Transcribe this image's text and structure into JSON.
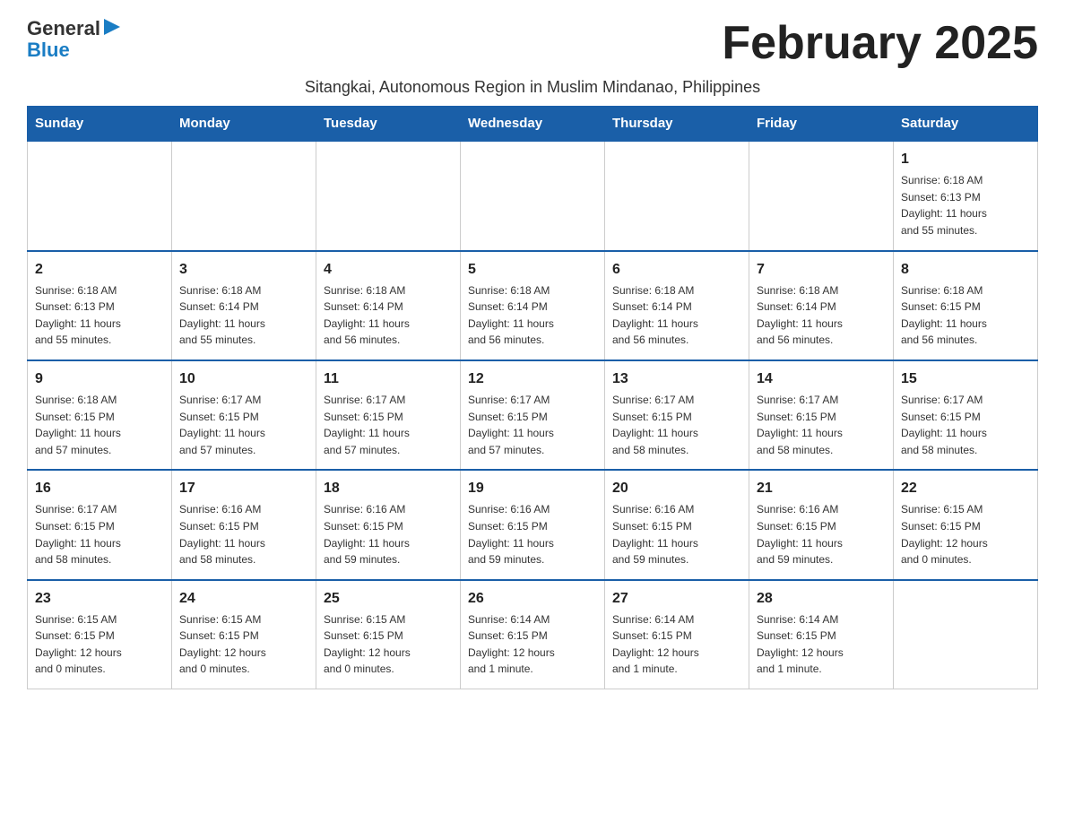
{
  "logo": {
    "general": "General",
    "blue": "Blue",
    "arrow": "▶"
  },
  "header": {
    "month_title": "February 2025",
    "subtitle": "Sitangkai, Autonomous Region in Muslim Mindanao, Philippines"
  },
  "days_of_week": [
    "Sunday",
    "Monday",
    "Tuesday",
    "Wednesday",
    "Thursday",
    "Friday",
    "Saturday"
  ],
  "weeks": [
    [
      {
        "day": "",
        "info": ""
      },
      {
        "day": "",
        "info": ""
      },
      {
        "day": "",
        "info": ""
      },
      {
        "day": "",
        "info": ""
      },
      {
        "day": "",
        "info": ""
      },
      {
        "day": "",
        "info": ""
      },
      {
        "day": "1",
        "info": "Sunrise: 6:18 AM\nSunset: 6:13 PM\nDaylight: 11 hours\nand 55 minutes."
      }
    ],
    [
      {
        "day": "2",
        "info": "Sunrise: 6:18 AM\nSunset: 6:13 PM\nDaylight: 11 hours\nand 55 minutes."
      },
      {
        "day": "3",
        "info": "Sunrise: 6:18 AM\nSunset: 6:14 PM\nDaylight: 11 hours\nand 55 minutes."
      },
      {
        "day": "4",
        "info": "Sunrise: 6:18 AM\nSunset: 6:14 PM\nDaylight: 11 hours\nand 56 minutes."
      },
      {
        "day": "5",
        "info": "Sunrise: 6:18 AM\nSunset: 6:14 PM\nDaylight: 11 hours\nand 56 minutes."
      },
      {
        "day": "6",
        "info": "Sunrise: 6:18 AM\nSunset: 6:14 PM\nDaylight: 11 hours\nand 56 minutes."
      },
      {
        "day": "7",
        "info": "Sunrise: 6:18 AM\nSunset: 6:14 PM\nDaylight: 11 hours\nand 56 minutes."
      },
      {
        "day": "8",
        "info": "Sunrise: 6:18 AM\nSunset: 6:15 PM\nDaylight: 11 hours\nand 56 minutes."
      }
    ],
    [
      {
        "day": "9",
        "info": "Sunrise: 6:18 AM\nSunset: 6:15 PM\nDaylight: 11 hours\nand 57 minutes."
      },
      {
        "day": "10",
        "info": "Sunrise: 6:17 AM\nSunset: 6:15 PM\nDaylight: 11 hours\nand 57 minutes."
      },
      {
        "day": "11",
        "info": "Sunrise: 6:17 AM\nSunset: 6:15 PM\nDaylight: 11 hours\nand 57 minutes."
      },
      {
        "day": "12",
        "info": "Sunrise: 6:17 AM\nSunset: 6:15 PM\nDaylight: 11 hours\nand 57 minutes."
      },
      {
        "day": "13",
        "info": "Sunrise: 6:17 AM\nSunset: 6:15 PM\nDaylight: 11 hours\nand 58 minutes."
      },
      {
        "day": "14",
        "info": "Sunrise: 6:17 AM\nSunset: 6:15 PM\nDaylight: 11 hours\nand 58 minutes."
      },
      {
        "day": "15",
        "info": "Sunrise: 6:17 AM\nSunset: 6:15 PM\nDaylight: 11 hours\nand 58 minutes."
      }
    ],
    [
      {
        "day": "16",
        "info": "Sunrise: 6:17 AM\nSunset: 6:15 PM\nDaylight: 11 hours\nand 58 minutes."
      },
      {
        "day": "17",
        "info": "Sunrise: 6:16 AM\nSunset: 6:15 PM\nDaylight: 11 hours\nand 58 minutes."
      },
      {
        "day": "18",
        "info": "Sunrise: 6:16 AM\nSunset: 6:15 PM\nDaylight: 11 hours\nand 59 minutes."
      },
      {
        "day": "19",
        "info": "Sunrise: 6:16 AM\nSunset: 6:15 PM\nDaylight: 11 hours\nand 59 minutes."
      },
      {
        "day": "20",
        "info": "Sunrise: 6:16 AM\nSunset: 6:15 PM\nDaylight: 11 hours\nand 59 minutes."
      },
      {
        "day": "21",
        "info": "Sunrise: 6:16 AM\nSunset: 6:15 PM\nDaylight: 11 hours\nand 59 minutes."
      },
      {
        "day": "22",
        "info": "Sunrise: 6:15 AM\nSunset: 6:15 PM\nDaylight: 12 hours\nand 0 minutes."
      }
    ],
    [
      {
        "day": "23",
        "info": "Sunrise: 6:15 AM\nSunset: 6:15 PM\nDaylight: 12 hours\nand 0 minutes."
      },
      {
        "day": "24",
        "info": "Sunrise: 6:15 AM\nSunset: 6:15 PM\nDaylight: 12 hours\nand 0 minutes."
      },
      {
        "day": "25",
        "info": "Sunrise: 6:15 AM\nSunset: 6:15 PM\nDaylight: 12 hours\nand 0 minutes."
      },
      {
        "day": "26",
        "info": "Sunrise: 6:14 AM\nSunset: 6:15 PM\nDaylight: 12 hours\nand 1 minute."
      },
      {
        "day": "27",
        "info": "Sunrise: 6:14 AM\nSunset: 6:15 PM\nDaylight: 12 hours\nand 1 minute."
      },
      {
        "day": "28",
        "info": "Sunrise: 6:14 AM\nSunset: 6:15 PM\nDaylight: 12 hours\nand 1 minute."
      },
      {
        "day": "",
        "info": ""
      }
    ]
  ]
}
